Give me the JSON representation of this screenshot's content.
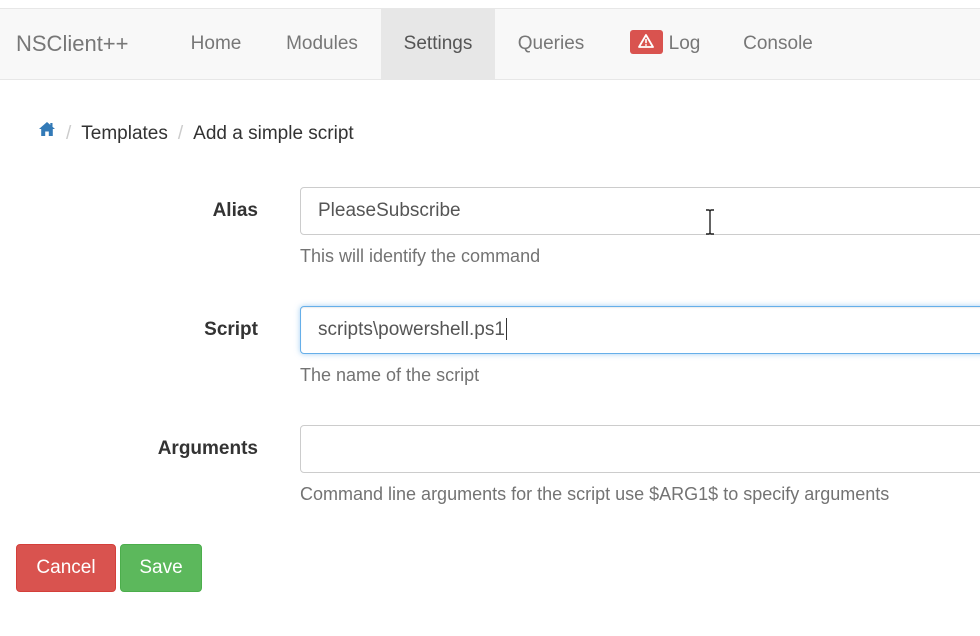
{
  "navbar": {
    "brand": "NSClient++",
    "items": [
      {
        "label": "Home",
        "active": false
      },
      {
        "label": "Modules",
        "active": false
      },
      {
        "label": "Settings",
        "active": true
      },
      {
        "label": "Queries",
        "active": false
      },
      {
        "label": "Log",
        "active": false,
        "badge_icon": "warning-icon"
      },
      {
        "label": "Console",
        "active": false
      }
    ]
  },
  "breadcrumb": {
    "home_icon": "home-icon",
    "items": [
      "Templates",
      "Add a simple script"
    ]
  },
  "form": {
    "alias": {
      "label": "Alias",
      "value": "PleaseSubscribe",
      "help": "This will identify the command"
    },
    "script": {
      "label": "Script",
      "value": "scripts\\powershell.ps1",
      "help": "The name of the script"
    },
    "arguments": {
      "label": "Arguments",
      "value": "",
      "help": "Command line arguments for the script use $ARG1$ to specify arguments"
    }
  },
  "buttons": {
    "cancel": "Cancel",
    "save": "Save"
  },
  "colors": {
    "danger": "#d9534f",
    "success": "#5cb85c",
    "link": "#337ab7",
    "focus": "#66afe9"
  }
}
